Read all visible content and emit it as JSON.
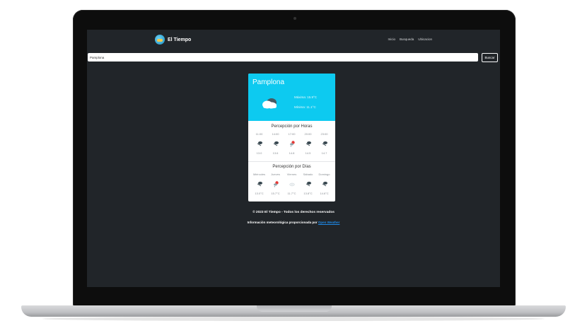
{
  "nav": {
    "brand": "El Tiempo",
    "links": [
      "Inicio",
      "Busqueda",
      "Ubicacion"
    ]
  },
  "search": {
    "value": "Pamplona",
    "button": "Buscar"
  },
  "weather": {
    "city": "Pamplona",
    "max": "Máxima: 15.9°C",
    "min": "Mínima: 11.1°C",
    "current_icon": "cloud-icon",
    "hours_title": "Percepción por Horas",
    "hours": [
      {
        "time": "11:00",
        "icon": "drizzle-icon",
        "value": "13.0"
      },
      {
        "time": "14:00",
        "icon": "drizzle-icon",
        "value": "13.6"
      },
      {
        "time": "17:00",
        "icon": "sun-rain-icon",
        "value": "14.8"
      },
      {
        "time": "20:00",
        "icon": "drizzle-icon",
        "value": "14.5"
      },
      {
        "time": "23:00",
        "icon": "drizzle-icon",
        "value": "14.7"
      }
    ],
    "days_title": "Percepción por Días",
    "days": [
      {
        "day": "Miércoles",
        "icon": "drizzle-icon",
        "value": "13.0°C"
      },
      {
        "day": "Jueves",
        "icon": "sun-rain-icon",
        "value": "15.7°C"
      },
      {
        "day": "Viernes",
        "icon": "light-cloud-icon",
        "value": "11.7°C"
      },
      {
        "day": "Sábado",
        "icon": "drizzle-icon",
        "value": "13.8°C"
      },
      {
        "day": "Domingo",
        "icon": "drizzle-icon",
        "value": "14.6°C"
      }
    ]
  },
  "footer": {
    "copyright": "© 2023 El Tiempo - Todos los derechos reservados",
    "info_prefix": "Información meteorológica proporcionada por",
    "info_link": "Open Weather"
  },
  "colors": {
    "screen_bg": "#212529",
    "card_header": "#0dcaf0",
    "link": "#1e88e5"
  }
}
